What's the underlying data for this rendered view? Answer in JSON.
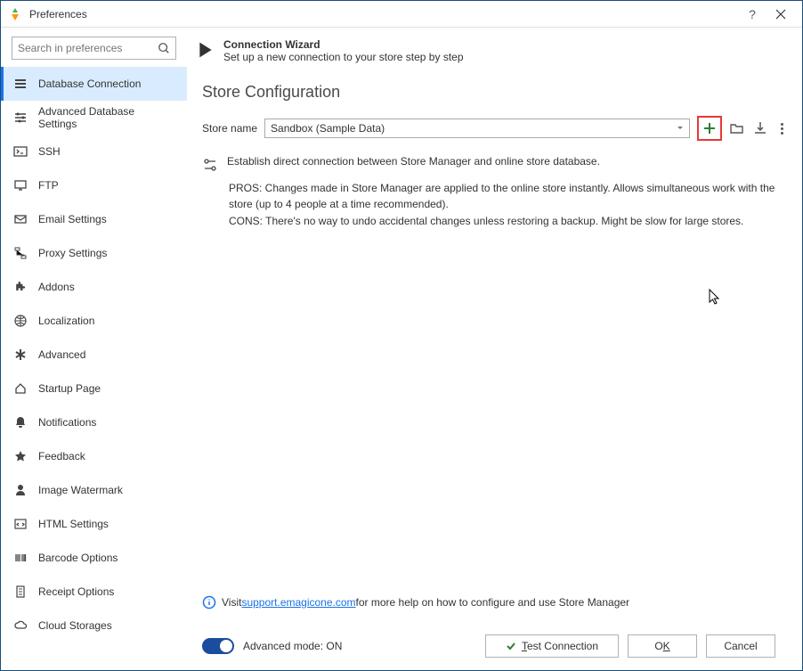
{
  "window": {
    "title": "Preferences"
  },
  "search": {
    "placeholder": "Search in preferences"
  },
  "sidebar": {
    "items": [
      {
        "label": "Database Connection",
        "selected": true
      },
      {
        "label": "Advanced Database Settings"
      },
      {
        "label": "SSH"
      },
      {
        "label": "FTP"
      },
      {
        "label": "Email Settings"
      },
      {
        "label": "Proxy Settings"
      },
      {
        "label": "Addons"
      },
      {
        "label": "Localization"
      },
      {
        "label": "Advanced"
      },
      {
        "label": "Startup Page"
      },
      {
        "label": "Notifications"
      },
      {
        "label": "Feedback"
      },
      {
        "label": "Image Watermark"
      },
      {
        "label": "HTML Settings"
      },
      {
        "label": "Barcode Options"
      },
      {
        "label": "Receipt Options"
      },
      {
        "label": "Cloud Storages"
      }
    ]
  },
  "main": {
    "wizard": {
      "title": "Connection Wizard",
      "subtitle": "Set up a new connection to your store step by step"
    },
    "section_title": "Store Configuration",
    "store_name_label": "Store name",
    "store_name_value": "Sandbox (Sample Data)",
    "description": "Establish direct connection between Store Manager and online store database.",
    "pros_label": "PROS:",
    "pros_text": " Changes made in Store Manager are applied to the online store instantly. Allows simultaneous work with the store (up to 4 people at a time recommended).",
    "cons_label": "CONS:",
    "cons_text": " There's no way to undo accidental changes unless restoring a backup. Might be slow for large stores.",
    "help": {
      "prefix": "Visit ",
      "link": "support.emagicone.com",
      "suffix": " for more help on how to configure and use Store Manager"
    }
  },
  "footer": {
    "advanced_label": "Advanced mode: ON",
    "test_label": "Test Connection",
    "ok_prefix": "O",
    "ok_ul": "K",
    "cancel_label": "Cancel",
    "test_ul": "T",
    "test_rest": "est Connection"
  }
}
